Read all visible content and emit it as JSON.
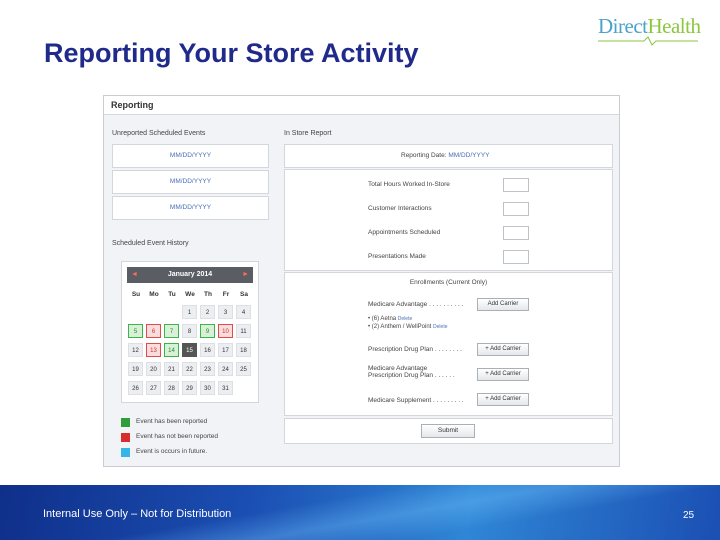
{
  "slide": {
    "title": "Reporting Your Store Activity",
    "logo_direct": "Direct",
    "logo_health": "Health",
    "footer_text": "Internal Use Only – Not for Distribution",
    "page_number": "25"
  },
  "app": {
    "header": "Reporting",
    "unreported_label": "Unreported Scheduled Events",
    "in_store_label": "In Store Report",
    "date_placeholders": [
      "MM/DD/YYYY",
      "MM/DD/YYYY",
      "MM/DD/YYYY"
    ],
    "reporting_date_label": "Reporting Date:",
    "reporting_date_value": "MM/DD/YYYY",
    "metrics": [
      "Total Hours Worked In-Store",
      "Customer Interactions",
      "Appointments Scheduled",
      "Presentations Made"
    ],
    "enrollment_title": "Enrollments (Current Only)",
    "plans": [
      {
        "label": "Medicare Advantage . . . . . . . . . .",
        "button": "Add Carrier"
      },
      {
        "label": "Prescription Drug Plan . . . . . . . .",
        "button": "+ Add Carrier"
      },
      {
        "label": "Medicare Advantage\nPrescription Drug Plan . . . . . .",
        "button": "+ Add Carrier"
      },
      {
        "label": "Medicare Supplement . . . . . . . . .",
        "button": "+ Add Carrier"
      }
    ],
    "carriers": [
      {
        "label": "• (6) Aetna",
        "delete": "Delete"
      },
      {
        "label": "• (2) Anthem / WellPoint",
        "delete": "Delete"
      }
    ],
    "submit": "Submit",
    "history_label": "Scheduled Event History",
    "calendar": {
      "month": "January 2014",
      "prev": "◄",
      "next": "►",
      "weekdays": [
        "Su",
        "Mo",
        "Tu",
        "We",
        "Th",
        "Fr",
        "Sa"
      ],
      "weeks": [
        [
          "",
          "",
          "",
          "1",
          "2",
          "3",
          "4"
        ],
        [
          "5",
          "6",
          "7",
          "8",
          "9",
          "10",
          "11"
        ],
        [
          "12",
          "13",
          "14",
          "15",
          "16",
          "17",
          "18"
        ],
        [
          "19",
          "20",
          "21",
          "22",
          "23",
          "24",
          "25"
        ],
        [
          "26",
          "27",
          "28",
          "29",
          "30",
          "31",
          ""
        ]
      ],
      "green_days": [
        "5",
        "7",
        "9",
        "14"
      ],
      "red_days": [
        "6",
        "10",
        "13"
      ],
      "today": "15"
    },
    "legend": [
      {
        "color": "#2e9e3a",
        "text": "Event has been reported"
      },
      {
        "color": "#d62d2d",
        "text": "Event has not been reported"
      },
      {
        "color": "#37b5e6",
        "text": "Event is occurs in future."
      }
    ]
  }
}
